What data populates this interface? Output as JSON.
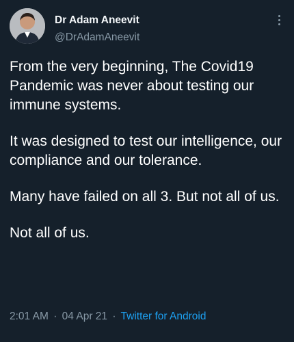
{
  "author": {
    "display_name": "Dr Adam Aneevit",
    "handle": "@DrAdamAneevit",
    "avatar_icon": "profile-photo"
  },
  "menu_icon": "more-vertical-icon",
  "tweet": {
    "paragraphs": [
      "From the very beginning, The Covid19 Pandemic was never about testing our immune systems.",
      "It was designed to test our intelligence, our compliance and our tolerance.",
      "Many have failed on all 3. But not all of us.",
      "Not all of us."
    ]
  },
  "meta": {
    "time": "2:01 AM",
    "separator": "·",
    "date": "04 Apr 21",
    "source": "Twitter for Android"
  },
  "colors": {
    "background": "#15202b",
    "text": "#ffffff",
    "secondary": "#8899a6",
    "link": "#1da1f2"
  }
}
